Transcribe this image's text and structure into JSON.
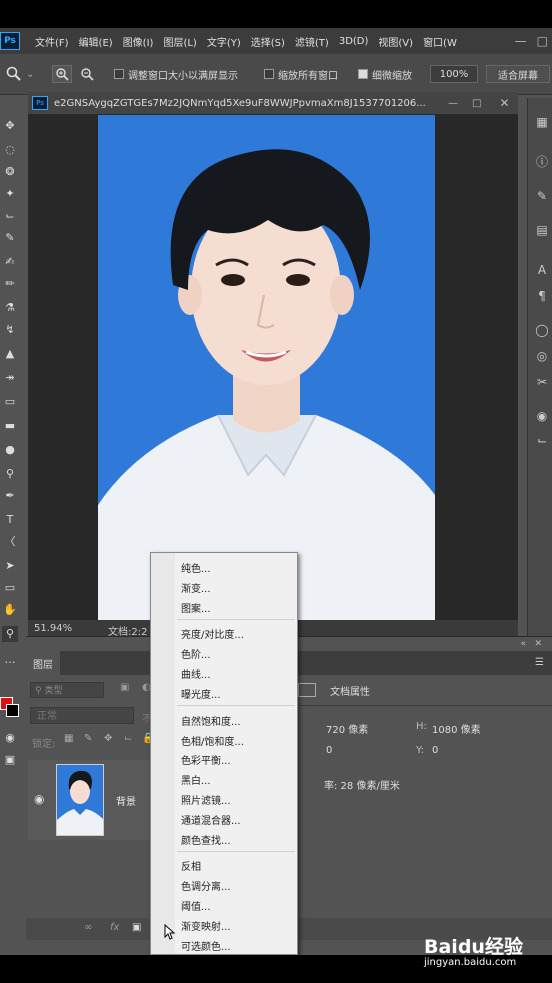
{
  "menubar": {
    "logo": "Ps",
    "items": [
      "文件(F)",
      "编辑(E)",
      "图像(I)",
      "图层(L)",
      "文字(Y)",
      "选择(S)",
      "滤镜(T)",
      "3D(D)",
      "视图(V)",
      "窗口(W"
    ]
  },
  "options_bar": {
    "resize_windows": "调整窗口大小以满屏显示",
    "zoom_all_windows": "缩放所有窗口",
    "scrubby_zoom": "细微缩放",
    "zoom_value": "100%",
    "fit_screen": "适合屏幕"
  },
  "document": {
    "title": "e2GNSAygqZGTGEs7Mz2JQNmYqd5Xe9uF8WWJPpvmaXm8J1537701206...",
    "zoom": "51.94%",
    "doc_label": "文档:2:2"
  },
  "layers_panel": {
    "tab": "图层",
    "kind_filter": "类型",
    "blend_mode": "正常",
    "opacity_label": "不",
    "lock_label": "锁定:",
    "layer_name": "背景"
  },
  "properties_panel": {
    "title": "文档属性",
    "width": "720 像素",
    "height_label": "H:",
    "height": "1080 像素",
    "x": "0",
    "y_label": "Y:",
    "y": "0",
    "resolution": "率: 28 像素/厘米"
  },
  "context_menu": {
    "items": [
      "纯色...",
      "渐变...",
      "图案...",
      "亮度/对比度...",
      "色阶...",
      "曲线...",
      "曝光度...",
      "自然饱和度...",
      "色相/饱和度...",
      "色彩平衡...",
      "黑白...",
      "照片滤镜...",
      "通道混合器...",
      "颜色查找...",
      "反相",
      "色调分离...",
      "阈值...",
      "渐变映射...",
      "可选颜色..."
    ]
  },
  "watermark": {
    "brand": "Baidu经验",
    "url": "jingyan.baidu.com"
  },
  "colors": {
    "photo_bg": "#2f79d9",
    "ui_bg": "#535353",
    "menu_bg": "#f0f0f0"
  }
}
